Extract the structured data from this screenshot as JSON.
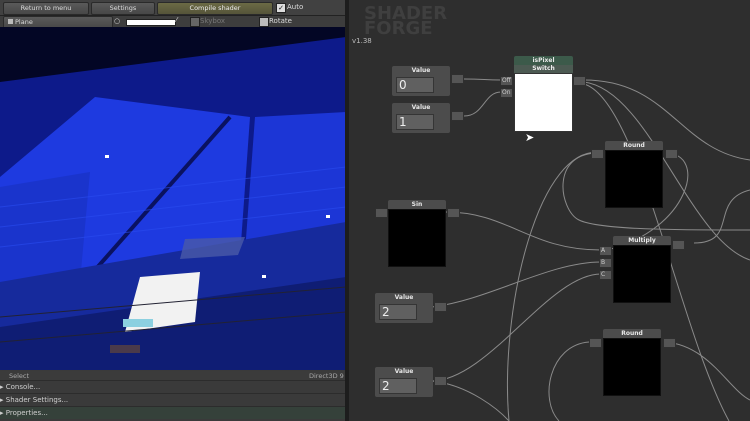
{
  "toolbar": {
    "return_label": "Return to menu",
    "settings_label": "Settings",
    "compile_label": "Compile shader",
    "auto_label": "Auto"
  },
  "preview_bar": {
    "mesh_label": "Plane",
    "skybox_label": "Skybox",
    "rotate_label": "Rotate"
  },
  "status": {
    "select_label": "Select",
    "renderer_label": "Direct3D 9"
  },
  "foldouts": {
    "console": "Console...",
    "shader_settings": "Shader Settings...",
    "properties": "Properties..."
  },
  "brand": {
    "line1": "SHADER",
    "line2": "FORGE",
    "version": "v1.38"
  },
  "nodes": {
    "value1": {
      "title": "Value",
      "value": "0"
    },
    "value2": {
      "title": "Value",
      "value": "1"
    },
    "ispixel": {
      "title": "isPixel",
      "subtitle": "Switch",
      "off_label": "Off",
      "on_label": "On"
    },
    "round1": {
      "title": "Round"
    },
    "sin": {
      "title": "Sin"
    },
    "multiply": {
      "title": "Multiply",
      "in_a": "A",
      "in_b": "B",
      "in_c": "C"
    },
    "value3": {
      "title": "Value",
      "value": "2"
    },
    "round2": {
      "title": "Round"
    },
    "value4": {
      "title": "Value",
      "value": "2"
    }
  },
  "colors": {
    "accent_green": "#3c5a4a",
    "canvas_bg": "#2e2e2e",
    "node_bg": "#4c4c4c"
  }
}
